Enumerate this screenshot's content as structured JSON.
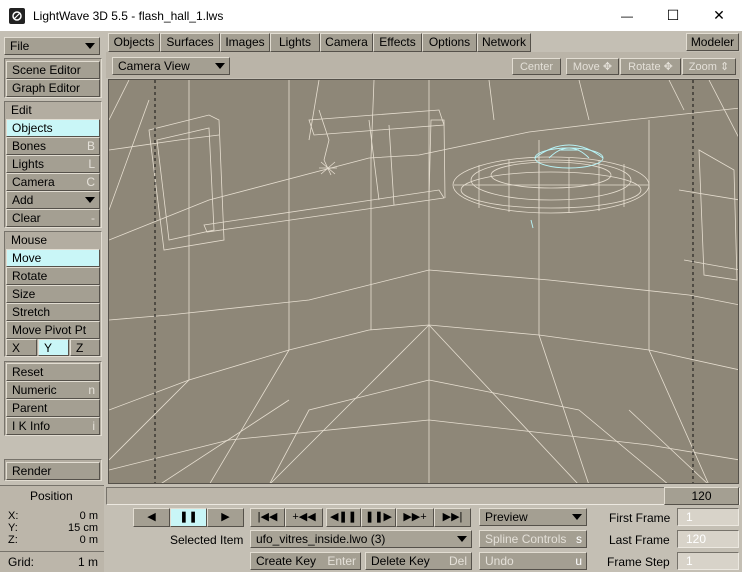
{
  "window": {
    "title": "LightWave 3D 5.5 - flash_hall_1.lws",
    "minimize": "—",
    "maximize": "☐",
    "close": "✕"
  },
  "menubar": {
    "file": "File",
    "tabs": [
      "Objects",
      "Surfaces",
      "Images",
      "Lights",
      "Camera",
      "Effects",
      "Options",
      "Network"
    ],
    "modeler": "Modeler"
  },
  "left": {
    "scene_editor": "Scene Editor",
    "graph_editor": "Graph Editor",
    "edit_label": "Edit",
    "edit_items": [
      {
        "label": "Objects",
        "shortcut": ""
      },
      {
        "label": "Bones",
        "shortcut": "B"
      },
      {
        "label": "Lights",
        "shortcut": "L"
      },
      {
        "label": "Camera",
        "shortcut": "C"
      }
    ],
    "add": "Add",
    "clear": "Clear",
    "clear_shortcut": "-",
    "mouse_label": "Mouse",
    "mouse_items": [
      "Move",
      "Rotate",
      "Size",
      "Stretch",
      "Move Pivot Pt"
    ],
    "axes": [
      "X",
      "Y",
      "Z"
    ],
    "reset": "Reset",
    "numeric": "Numeric",
    "numeric_shortcut": "n",
    "parent": "Parent",
    "ik_info": "I K Info",
    "ik_shortcut": "i",
    "render": "Render"
  },
  "position": {
    "title": "Position",
    "x_label": "X:",
    "x_value": "0 m",
    "y_label": "Y:",
    "y_value": "15 cm",
    "z_label": "Z:",
    "z_value": "0 m",
    "grid_label": "Grid:",
    "grid_value": "1 m"
  },
  "viewport": {
    "view_mode": "Camera View",
    "center": "Center",
    "move": "Move ✥",
    "rotate": "Rotate ✥",
    "zoom": "Zoom ⇕"
  },
  "timeline": {
    "current_frame": "120"
  },
  "transport": {
    "play_back": "◀",
    "pause": "❚❚",
    "play_fwd": "▶",
    "first": "|◀◀",
    "prev_key": "+◀◀",
    "step_back": "◀❚❚",
    "step_fwd": "❚❚▶",
    "next_key": "▶▶+",
    "last": "▶▶|"
  },
  "selected": {
    "label": "Selected Item",
    "value": "ufo_vitres_inside.lwo (3)"
  },
  "keys": {
    "create": "Create Key",
    "create_sc": "Enter",
    "delete": "Delete Key",
    "delete_sc": "Del"
  },
  "preview": "Preview",
  "spline": {
    "label": "Spline Controls",
    "sc": "s"
  },
  "undo": {
    "label": "Undo",
    "sc": "u"
  },
  "frames": {
    "first_label": "First Frame",
    "first_value": "1",
    "last_label": "Last Frame",
    "last_value": "120",
    "step_label": "Frame Step",
    "step_value": "1"
  },
  "colors": {
    "accent_selected": "#c9f6f7",
    "wireframe": "#e6ded0",
    "viewport_bg": "#8e8778"
  }
}
